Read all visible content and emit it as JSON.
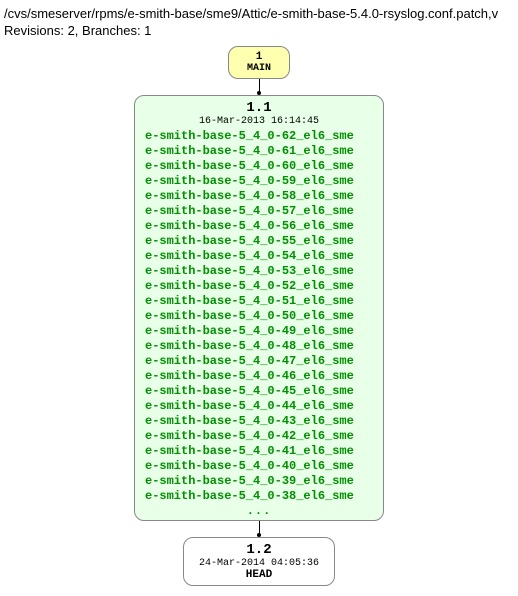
{
  "header": {
    "path": "/cvs/smeserver/rpms/e-smith-base/sme9/Attic/e-smith-base-5.4.0-rsyslog.conf.patch,v",
    "stats": "Revisions: 2, Branches: 1"
  },
  "main_node": {
    "num": "1",
    "label": "MAIN"
  },
  "rev1": {
    "num": "1.1",
    "date": "16-Mar-2013 16:14:45",
    "tags": [
      "e-smith-base-5_4_0-62_el6_sme",
      "e-smith-base-5_4_0-61_el6_sme",
      "e-smith-base-5_4_0-60_el6_sme",
      "e-smith-base-5_4_0-59_el6_sme",
      "e-smith-base-5_4_0-58_el6_sme",
      "e-smith-base-5_4_0-57_el6_sme",
      "e-smith-base-5_4_0-56_el6_sme",
      "e-smith-base-5_4_0-55_el6_sme",
      "e-smith-base-5_4_0-54_el6_sme",
      "e-smith-base-5_4_0-53_el6_sme",
      "e-smith-base-5_4_0-52_el6_sme",
      "e-smith-base-5_4_0-51_el6_sme",
      "e-smith-base-5_4_0-50_el6_sme",
      "e-smith-base-5_4_0-49_el6_sme",
      "e-smith-base-5_4_0-48_el6_sme",
      "e-smith-base-5_4_0-47_el6_sme",
      "e-smith-base-5_4_0-46_el6_sme",
      "e-smith-base-5_4_0-45_el6_sme",
      "e-smith-base-5_4_0-44_el6_sme",
      "e-smith-base-5_4_0-43_el6_sme",
      "e-smith-base-5_4_0-42_el6_sme",
      "e-smith-base-5_4_0-41_el6_sme",
      "e-smith-base-5_4_0-40_el6_sme",
      "e-smith-base-5_4_0-39_el6_sme",
      "e-smith-base-5_4_0-38_el6_sme"
    ],
    "ellipsis": "..."
  },
  "rev2": {
    "num": "1.2",
    "date": "24-Mar-2014 04:05:36",
    "head": "HEAD"
  }
}
